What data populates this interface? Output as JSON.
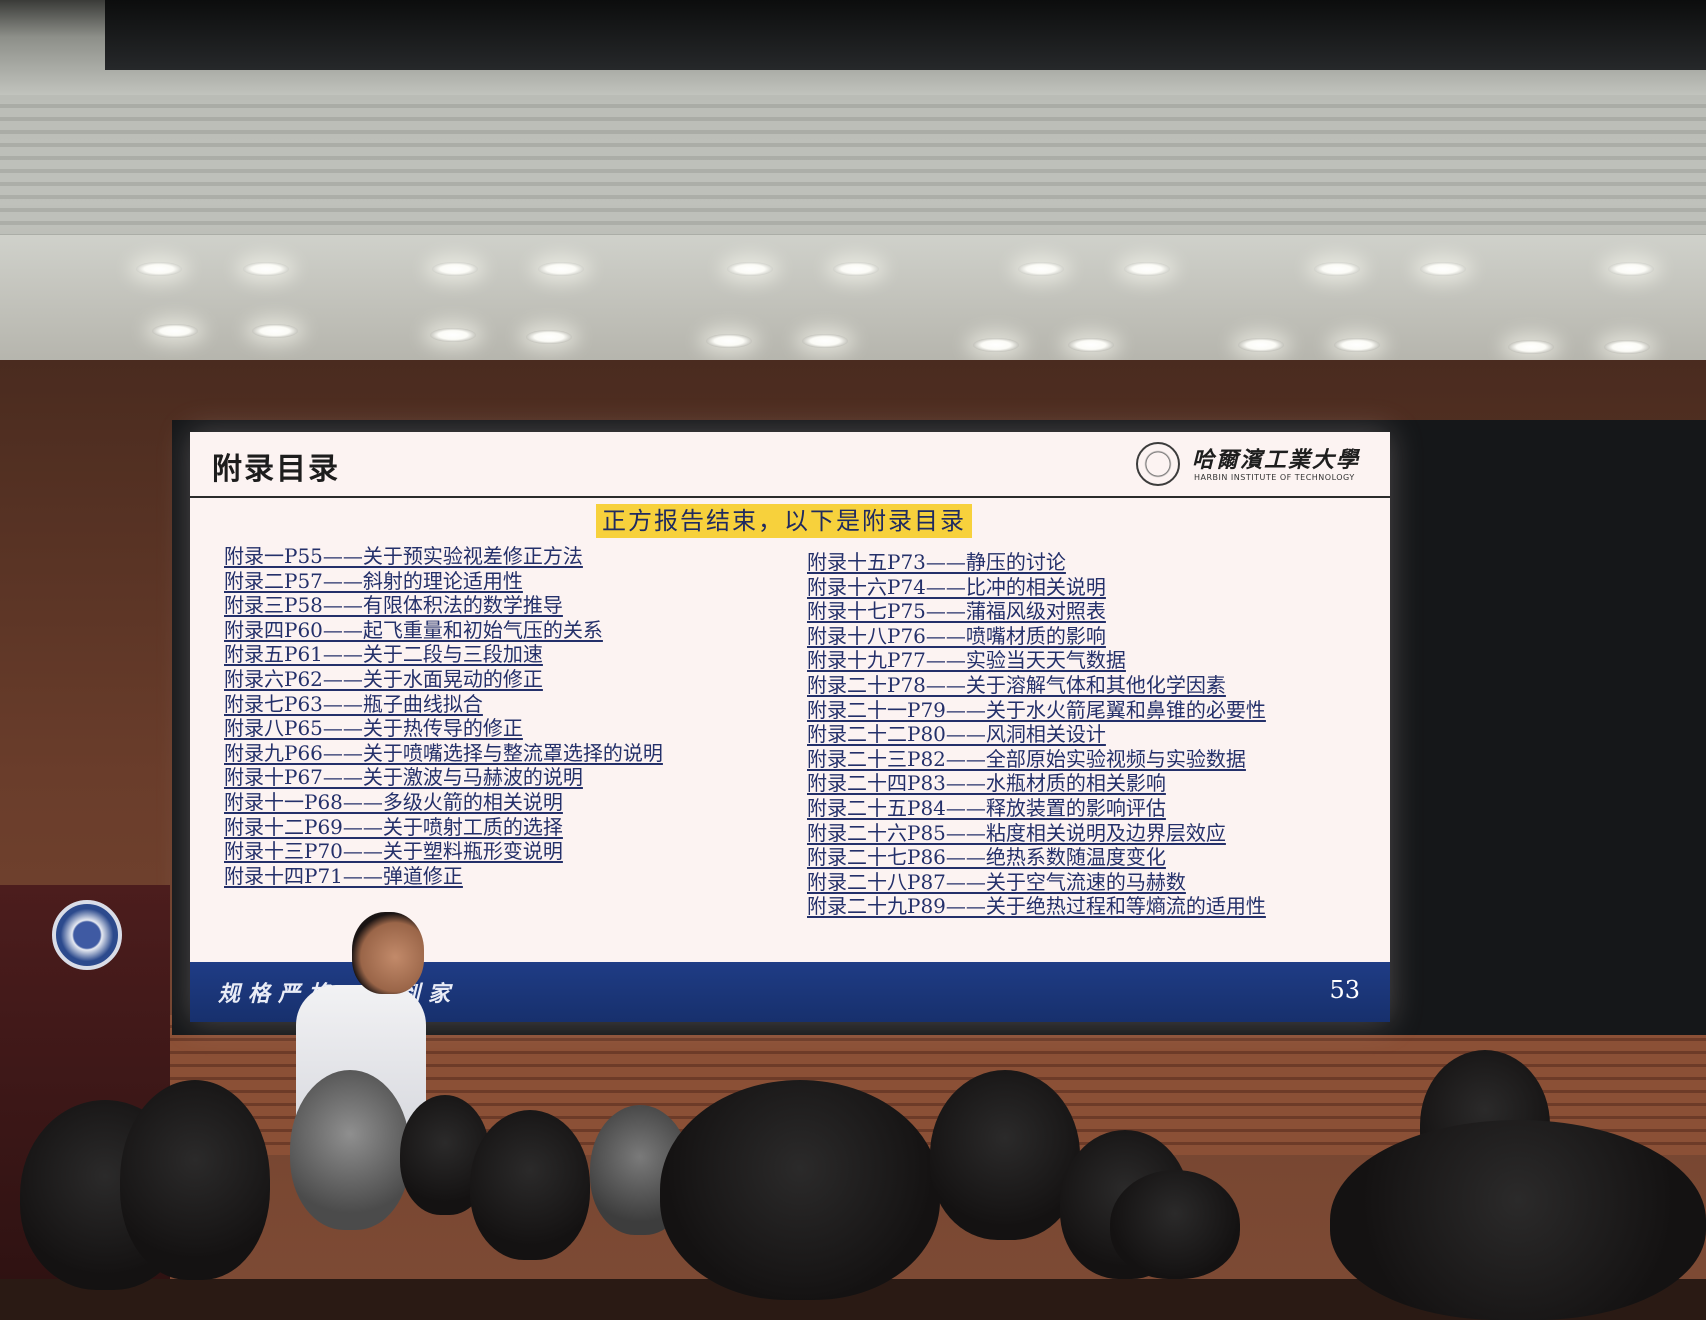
{
  "slide": {
    "title": "附录目录",
    "logo": {
      "name": "哈爾濱工業大學",
      "subtitle": "HARBIN INSTITUTE OF TECHNOLOGY"
    },
    "banner": "正方报告结束，以下是附录目录",
    "left_items": [
      "附录一P55——关于预实验视差修正方法",
      "附录二P57——斜射的理论适用性",
      "附录三P58——有限体积法的数学推导",
      "附录四P60——起飞重量和初始气压的关系",
      "附录五P61——关于二段与三段加速",
      "附录六P62——关于水面晃动的修正",
      "附录七P63——瓶子曲线拟合",
      "附录八P65——关于热传导的修正",
      "附录九P66——关于喷嘴选择与整流罩选择的说明",
      "附录十P67——关于激波与马赫波的说明",
      "附录十一P68——多级火箭的相关说明",
      "附录十二P69——关于喷射工质的选择",
      "附录十三P70——关于塑料瓶形变说明",
      "附录十四P71——弹道修正"
    ],
    "right_items": [
      "附录十五P73——静压的讨论",
      "附录十六P74——比冲的相关说明",
      "附录十七P75——蒲福风级对照表",
      "附录十八P76——喷嘴材质的影响",
      "附录十九P77——实验当天天气数据",
      "附录二十P78——关于溶解气体和其他化学因素",
      "附录二十一P79——关于水火箭尾翼和鼻锥的必要性",
      "附录二十二P80——风洞相关设计",
      "附录二十三P82——全部原始实验视频与实验数据",
      "附录二十四P83——水瓶材质的相关影响",
      "附录二十五P84——释放装置的影响评估",
      "附录二十六P85——粘度相关说明及边界层效应",
      "附录二十七P86——绝热系数随温度变化",
      "附录二十八P87——关于空气流速的马赫数",
      "附录二十九P89——关于绝热过程和等熵流的适用性"
    ],
    "footer": {
      "motto": "规格严格　　到家",
      "page_number": "53"
    }
  },
  "colors": {
    "slide_background": "#fcf3f2",
    "banner_highlight": "#f7d13c",
    "link_text": "#24306a",
    "footer_blue": "#1f3c85"
  }
}
